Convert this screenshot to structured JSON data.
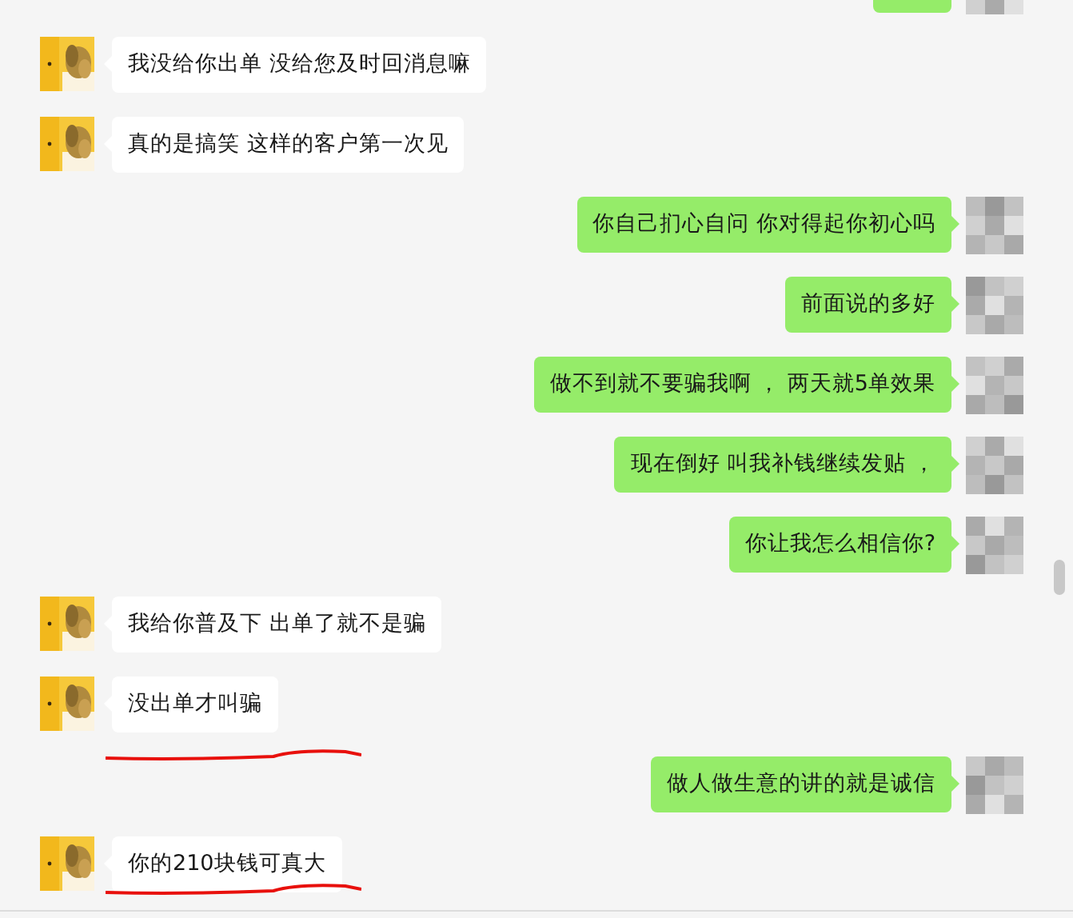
{
  "messages": [
    {
      "outgoing": true,
      "partial": true
    },
    {
      "outgoing": false,
      "text": "我没给你出单 没给您及时回消息嘛"
    },
    {
      "outgoing": false,
      "text": "真的是搞笑 这样的客户第一次见"
    },
    {
      "outgoing": true,
      "text": "你自己扪心自问  你对得起你初心吗"
    },
    {
      "outgoing": true,
      "text": "前面说的多好"
    },
    {
      "outgoing": true,
      "text": "做不到就不要骗我啊 ， 两天就5单效果"
    },
    {
      "outgoing": true,
      "text": "现在倒好 叫我补钱继续发贴 ，"
    },
    {
      "outgoing": true,
      "text": "你让我怎么相信你?"
    },
    {
      "outgoing": false,
      "text": "我给你普及下 出单了就不是骗"
    },
    {
      "outgoing": false,
      "text": "没出单才叫骗",
      "underlined": true
    },
    {
      "outgoing": true,
      "text": "做人做生意的讲的就是诚信"
    },
    {
      "outgoing": false,
      "text": "你的210块钱可真大",
      "underlined": true
    }
  ]
}
